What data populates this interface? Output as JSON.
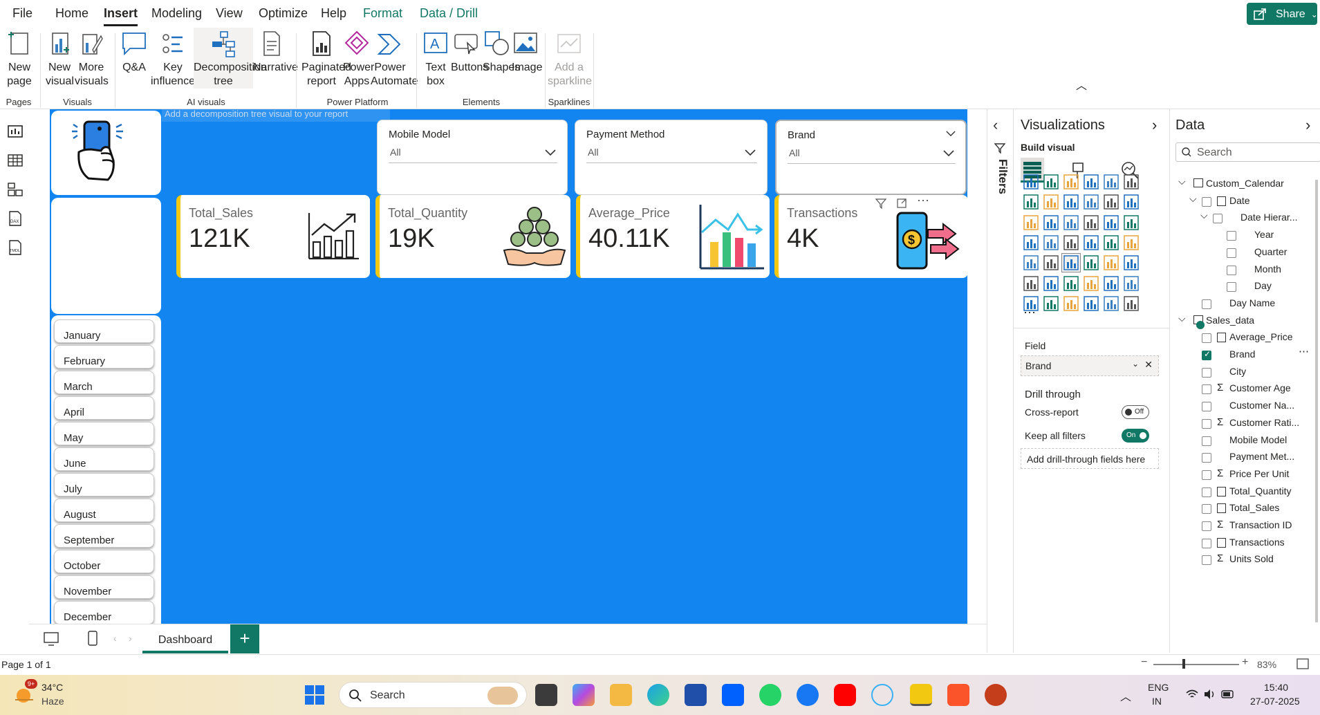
{
  "menu": {
    "tabs": [
      "File",
      "Home",
      "Insert",
      "Modeling",
      "View",
      "Optimize",
      "Help",
      "Format",
      "Data / Drill"
    ],
    "active": "Insert",
    "share": "Share"
  },
  "ribbon": {
    "new_page": "New page",
    "new_visual": "New visual",
    "more_visuals": "More visuals",
    "qa": "Q&A",
    "key_influencers": "Key influencers",
    "decomposition_tree": "Decomposition tree",
    "narrative": "Narrative",
    "paginated_report": "Paginated report",
    "power_apps": "Power Apps",
    "power_automate": "Power Automate",
    "text_box": "Text box",
    "buttons": "Buttons",
    "shapes": "Shapes",
    "image": "Image",
    "add_sparkline": "Add a sparkline",
    "groups": {
      "pages": "Pages",
      "visuals": "Visuals",
      "ai_visuals": "AI visuals",
      "power_platform": "Power Platform",
      "elements": "Elements",
      "sparklines": "Sparklines"
    }
  },
  "canvas": {
    "hint": "Add a decomposition tree visual to your report",
    "slicers": [
      {
        "title": "Mobile Model",
        "value": "All"
      },
      {
        "title": "Payment Method",
        "value": "All"
      },
      {
        "title": "Brand",
        "value": "All"
      }
    ],
    "kpis": [
      {
        "label": "Total_Sales",
        "value": "121K"
      },
      {
        "label": "Total_Quantity",
        "value": "19K"
      },
      {
        "label": "Average_Price",
        "value": "40.11K"
      },
      {
        "label": "Transactions",
        "value": "4K"
      }
    ],
    "months": [
      "January",
      "February",
      "March",
      "April",
      "May",
      "June",
      "July",
      "August",
      "September",
      "October",
      "November",
      "December"
    ]
  },
  "pages": {
    "tab": "Dashboard",
    "status": "Page 1 of 1",
    "zoom": "83%"
  },
  "filters": {
    "label": "Filters"
  },
  "viz": {
    "title": "Visualizations",
    "build": "Build visual",
    "field_label": "Field",
    "field_value": "Brand",
    "drill_through": "Drill through",
    "cross_report": "Cross-report",
    "cross_state": "Off",
    "keep_filters": "Keep all filters",
    "keep_state": "On",
    "add_drill": "Add drill-through fields here"
  },
  "data": {
    "title": "Data",
    "search_placeholder": "Search",
    "tables": [
      {
        "name": "Custom_Calendar"
      },
      {
        "name": "Sales_data"
      }
    ],
    "calendar_fields": [
      "Date",
      "Date Hierar...",
      "Year",
      "Quarter",
      "Month",
      "Day",
      "Day Name"
    ],
    "sales_fields": [
      "Average_Price",
      "Brand",
      "City",
      "Customer Age",
      "Customer Na...",
      "Customer Rati...",
      "Mobile Model",
      "Payment Met...",
      "Price Per Unit",
      "Total_Quantity",
      "Total_Sales",
      "Transaction ID",
      "Transactions",
      "Units Sold"
    ]
  },
  "taskbar": {
    "temp": "34°C",
    "weather": "Haze",
    "badge": "9+",
    "search": "Search",
    "lang1": "ENG",
    "lang2": "IN",
    "time": "15:40",
    "date": "27-07-2025"
  },
  "colors": {
    "accent": "#117865",
    "canvas": "#1285f0",
    "kpi_border": "#f2c811"
  }
}
